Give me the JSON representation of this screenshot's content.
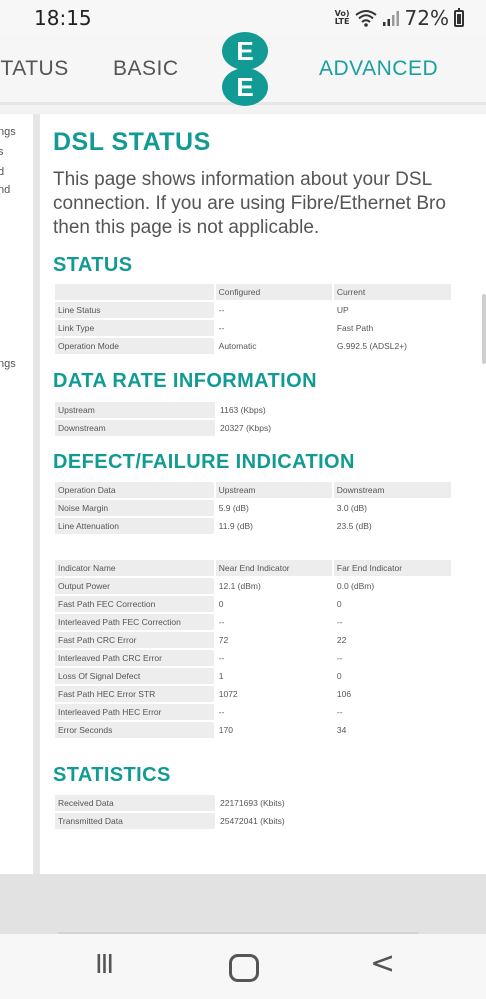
{
  "status_bar": {
    "time": "18:15",
    "signal_tag": "VoLTE",
    "battery": "72%"
  },
  "nav": {
    "status": "STATUS",
    "basic": "BASIC",
    "advanced": "ADVANCED",
    "logo_top": "E",
    "logo_bottom": "E"
  },
  "sidebar": {
    "items": [
      "ngs",
      "s",
      "d",
      "nd",
      "ngs"
    ]
  },
  "page": {
    "title": "DSL STATUS",
    "intro": [
      "This page shows information about your DSL",
      "connection. If you are using Fibre/Ethernet Bro",
      "then this page is not applicable."
    ]
  },
  "status_section": {
    "heading": "STATUS",
    "header": [
      "",
      "Configured",
      "Current"
    ],
    "rows": [
      [
        "Line Status",
        "--",
        "UP"
      ],
      [
        "Link Type",
        "--",
        "Fast Path"
      ],
      [
        "Operation Mode",
        "Automatic",
        "G.992.5 (ADSL2+)"
      ]
    ]
  },
  "data_rate": {
    "heading": "DATA RATE INFORMATION",
    "rows": [
      [
        "Upstream",
        "1163 (Kbps)"
      ],
      [
        "Downstream",
        "20327 (Kbps)"
      ]
    ]
  },
  "defect": {
    "heading": "DEFECT/FAILURE INDICATION",
    "op_header": [
      "Operation Data",
      "Upstream",
      "Downstream"
    ],
    "op_rows": [
      [
        "Noise Margin",
        "5.9 (dB)",
        "3.0 (dB)"
      ],
      [
        "Line Attenuation",
        "11.9 (dB)",
        "23.5 (dB)"
      ]
    ],
    "ind_header": [
      "Indicator Name",
      "Near End Indicator",
      "Far End Indicator"
    ],
    "ind_rows": [
      [
        "Output Power",
        "12.1 (dBm)",
        "0.0 (dBm)"
      ],
      [
        "Fast Path FEC Correction",
        "0",
        "0"
      ],
      [
        "Interleaved Path FEC Correction",
        "--",
        "--"
      ],
      [
        "Fast Path CRC Error",
        "72",
        "22"
      ],
      [
        "Interleaved Path CRC Error",
        "--",
        "--"
      ],
      [
        "Loss Of Signal Defect",
        "1",
        "0"
      ],
      [
        "Fast Path HEC Error STR",
        "1072",
        "106"
      ],
      [
        "Interleaved Path HEC Error",
        "--",
        "--"
      ],
      [
        "Error Seconds",
        "170",
        "34"
      ]
    ]
  },
  "statistics": {
    "heading": "STATISTICS",
    "rows": [
      [
        "Received Data",
        "22171693 (Kbits)"
      ],
      [
        "Transmitted Data",
        "25472041 (Kbits)"
      ]
    ]
  },
  "android_nav": {
    "recent": "III",
    "back": "<"
  }
}
